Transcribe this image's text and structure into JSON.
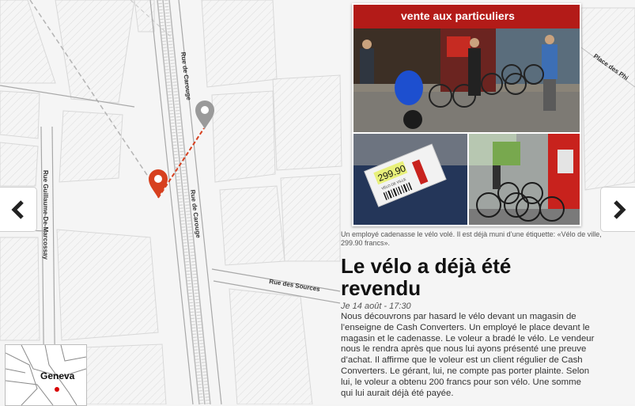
{
  "map": {
    "streets": {
      "rue_de_carouge_top": "Rue de Carouge",
      "rue_de_carouge_mid": "Rue de Carouge",
      "rue_guillaume": "Rue Guillaume-De-Marcossay",
      "rue_des_sources": "Rue des Sources",
      "place": "Place des Phi"
    },
    "minimap_label": "Geneva"
  },
  "photo": {
    "shop_sign": "vente aux particuliers",
    "price_tag": "299.90",
    "price_sub": "VÉLO DE VILLE",
    "caption": "Un employé cadenasse le vélo volé. Il est déjà muni d’une étiquette: «Vélo de ville, 299.90 francs»."
  },
  "article": {
    "title": "Le vélo a déjà été revendu",
    "date": "Je 14 août - 17:30",
    "body": "Nous découvrons par hasard le vélo devant un magasin de l’enseigne de Cash Converters. Un employé le place devant le magasin et le cadenasse. Le voleur a bradé le vélo. Le vendeur nous le rendra après que nous lui ayons présenté une preuve d’achat. Il affirme que le voleur est un client régulier de Cash Converters. Le gérant, lui, ne compte pas porter plainte. Selon lui, le voleur a obtenu 200 francs pour son vélo. Une somme qui lui aurait déjà été payée."
  },
  "nav": {
    "prev_icon": "chevron-left-icon",
    "next_icon": "chevron-right-icon"
  },
  "colors": {
    "accent": "#d7401f",
    "gray_pin": "#9a9a9a"
  }
}
